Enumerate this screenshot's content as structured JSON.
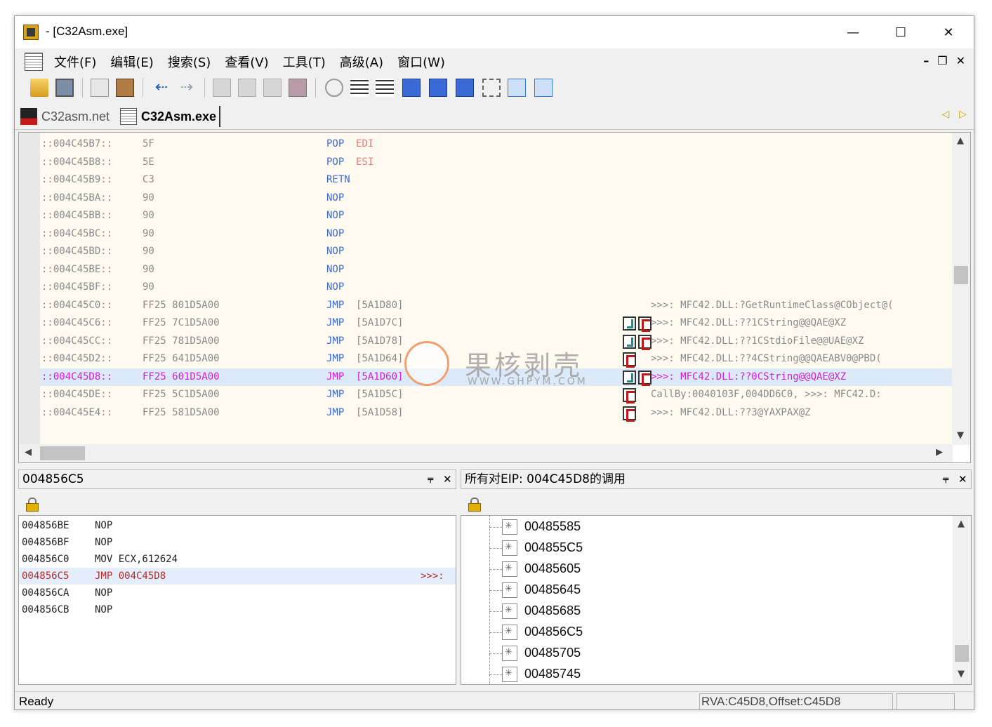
{
  "window": {
    "title": " - [C32Asm.exe]",
    "controls": {
      "minimize": "—",
      "maximize": "☐",
      "close": "✕"
    }
  },
  "menu": {
    "items": [
      "文件(F)",
      "编辑(E)",
      "搜索(S)",
      "查看(V)",
      "工具(T)",
      "高级(A)",
      "窗口(W)"
    ],
    "mdi_controls": [
      "–",
      "❐",
      "✕"
    ]
  },
  "tabs": [
    {
      "label": "C32asm.net",
      "active": false
    },
    {
      "label": "C32Asm.exe",
      "active": true
    }
  ],
  "tab_arrows": [
    "◁",
    "▷"
  ],
  "disasm": {
    "rows": [
      {
        "addr": "::004C45B7::",
        "bytes": "5F",
        "mnemonic": "POP",
        "operand": "EDI",
        "reg": true,
        "comment": "",
        "marks": []
      },
      {
        "addr": "::004C45B8::",
        "bytes": "5E",
        "mnemonic": "POP",
        "operand": "ESI",
        "reg": true,
        "comment": "",
        "marks": []
      },
      {
        "addr": "::004C45B9::",
        "bytes": "C3",
        "mnemonic": "RETN",
        "operand": "",
        "reg": false,
        "comment": "",
        "marks": []
      },
      {
        "addr": "::004C45BA::",
        "bytes": "90",
        "mnemonic": "NOP",
        "operand": "",
        "reg": false,
        "comment": "",
        "marks": []
      },
      {
        "addr": "::004C45BB::",
        "bytes": "90",
        "mnemonic": "NOP",
        "operand": "",
        "reg": false,
        "comment": "",
        "marks": []
      },
      {
        "addr": "::004C45BC::",
        "bytes": "90",
        "mnemonic": "NOP",
        "operand": "",
        "reg": false,
        "comment": "",
        "marks": []
      },
      {
        "addr": "::004C45BD::",
        "bytes": "90",
        "mnemonic": "NOP",
        "operand": "",
        "reg": false,
        "comment": "",
        "marks": []
      },
      {
        "addr": "::004C45BE::",
        "bytes": "90",
        "mnemonic": "NOP",
        "operand": "",
        "reg": false,
        "comment": "",
        "marks": []
      },
      {
        "addr": "::004C45BF::",
        "bytes": "90",
        "mnemonic": "NOP",
        "operand": "",
        "reg": false,
        "comment": "",
        "marks": []
      },
      {
        "addr": "::004C45C0::",
        "bytes": "FF25 801D5A00",
        "mnemonic": "JMP",
        "operand": "[5A1D80]",
        "reg": false,
        "comment": "    >>>: MFC42.DLL:?GetRuntimeClass@CObject@(",
        "marks": []
      },
      {
        "addr": "::004C45C6::",
        "bytes": "FF25 7C1D5A00",
        "mnemonic": "JMP",
        "operand": "[5A1D7C]",
        "reg": false,
        "comment": "         >>>: MFC42.DLL:??1CString@@QAE@XZ",
        "marks": [
          "j",
          "c"
        ]
      },
      {
        "addr": "::004C45CC::",
        "bytes": "FF25 781D5A00",
        "mnemonic": "JMP",
        "operand": "[5A1D78]",
        "reg": false,
        "comment": "         >>>: MFC42.DLL:??1CStdioFile@@UAE@XZ",
        "marks": [
          "j",
          "c"
        ]
      },
      {
        "addr": "::004C45D2::",
        "bytes": "FF25 641D5A00",
        "mnemonic": "JMP",
        "operand": "[5A1D64]",
        "reg": false,
        "comment": "       >>>: MFC42.DLL:??4CString@@QAEABV0@PBD(",
        "marks": [
          "c"
        ]
      },
      {
        "addr": "::004C45D8::",
        "bytes": "FF25 601D5A00",
        "mnemonic": "JMP",
        "operand": "[5A1D60]",
        "reg": false,
        "comment": "         >>>: MFC42.DLL:??0CString@@QAE@XZ",
        "marks": [
          "j",
          "c"
        ],
        "selected": true
      },
      {
        "addr": "::004C45DE::",
        "bytes": "FF25 5C1D5A00",
        "mnemonic": "JMP",
        "operand": "[5A1D5C]",
        "reg": false,
        "comment": "  CallBy:0040103F,004DD6C0,    >>>: MFC42.D:",
        "marks": [
          "c"
        ]
      },
      {
        "addr": "::004C45E4::",
        "bytes": "FF25 581D5A00",
        "mnemonic": "JMP",
        "operand": "[5A1D58]",
        "reg": false,
        "comment": "       >>>: MFC42.DLL:??3@YAXPAX@Z",
        "marks": [
          "c"
        ]
      }
    ]
  },
  "watermark": {
    "title": "果核剥壳",
    "url": "WWW.GHPYM.COM"
  },
  "left_panel": {
    "title": "004856C5",
    "pin": "⫧",
    "close": "✕",
    "rows": [
      {
        "addr": "004856BE",
        "ins": "NOP",
        "comment": ""
      },
      {
        "addr": "004856BF",
        "ins": "NOP",
        "comment": ""
      },
      {
        "addr": "004856C0",
        "ins": "MOV ECX,612624",
        "comment": ""
      },
      {
        "addr": "004856C5",
        "ins": "JMP 004C45D8",
        "comment": ">>>:",
        "selected": true
      },
      {
        "addr": "004856CA",
        "ins": "NOP",
        "comment": ""
      },
      {
        "addr": "004856CB",
        "ins": "NOP",
        "comment": ""
      }
    ]
  },
  "right_panel": {
    "title": "所有对EIP: 004C45D8的调用",
    "pin": "⫧",
    "close": "✕",
    "items": [
      "00485585",
      "004855C5",
      "00485605",
      "00485645",
      "00485685",
      "004856C5",
      "00485705",
      "00485745"
    ]
  },
  "status": {
    "text": "Ready",
    "rva": "RVA:C45D8,Offset:C45D8"
  },
  "colors": {
    "code_bg": "#fffaf0",
    "selected_row": "#dce9f8",
    "mnemonic": "#3a6ad6",
    "register": "#e87a7a",
    "selected_text": "#d21ed2"
  }
}
